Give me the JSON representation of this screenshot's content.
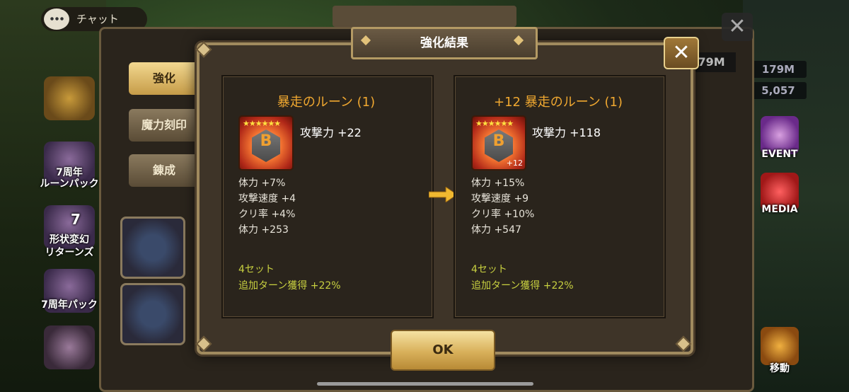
{
  "chat": {
    "label": "チャット"
  },
  "left_sidebar": [
    {
      "label": "7周年\nルーンパック",
      "label_l1": "7周年",
      "label_l2": "ルーンパック"
    },
    {
      "label_l1": "形状変幻",
      "label_l2": "リターンズ",
      "badge": "7"
    },
    {
      "label_l1": "7周年パック"
    }
  ],
  "right_sidebar": {
    "values": [
      "179M",
      "5,057"
    ],
    "event_label": "EVENT",
    "media_label": "MEDIA",
    "move_label": "移動"
  },
  "underlying": {
    "tabs": [
      "強化",
      "魔力刻印",
      "錬成"
    ],
    "mana_readout": "179M"
  },
  "modal": {
    "title": "強化結果",
    "ok_label": "OK",
    "before": {
      "title": "暴走のルーン (1)",
      "stars": "★★★★★★",
      "rune_letter": "B",
      "main_stat": "攻撃力 +22",
      "sub_stats": [
        "体力 +7%",
        "攻撃速度 +4",
        "クリ率 +4%",
        "体力 +253"
      ],
      "set_label": "4セット",
      "set_effect": "追加ターン獲得 +22%"
    },
    "after": {
      "title": "+12 暴走のルーン (1)",
      "stars": "★★★★★★",
      "rune_letter": "B",
      "level_badge": "+12",
      "main_stat": "攻撃力 +118",
      "sub_stats": [
        "体力 +15%",
        "攻撃速度 +9",
        "クリ率 +10%",
        "体力 +547"
      ],
      "set_label": "4セット",
      "set_effect": "追加ターン獲得 +22%"
    }
  },
  "colors": {
    "title_orange": "#f0a830",
    "set_yellow": "#c8d040",
    "frame_gold": "#a08a5e"
  }
}
